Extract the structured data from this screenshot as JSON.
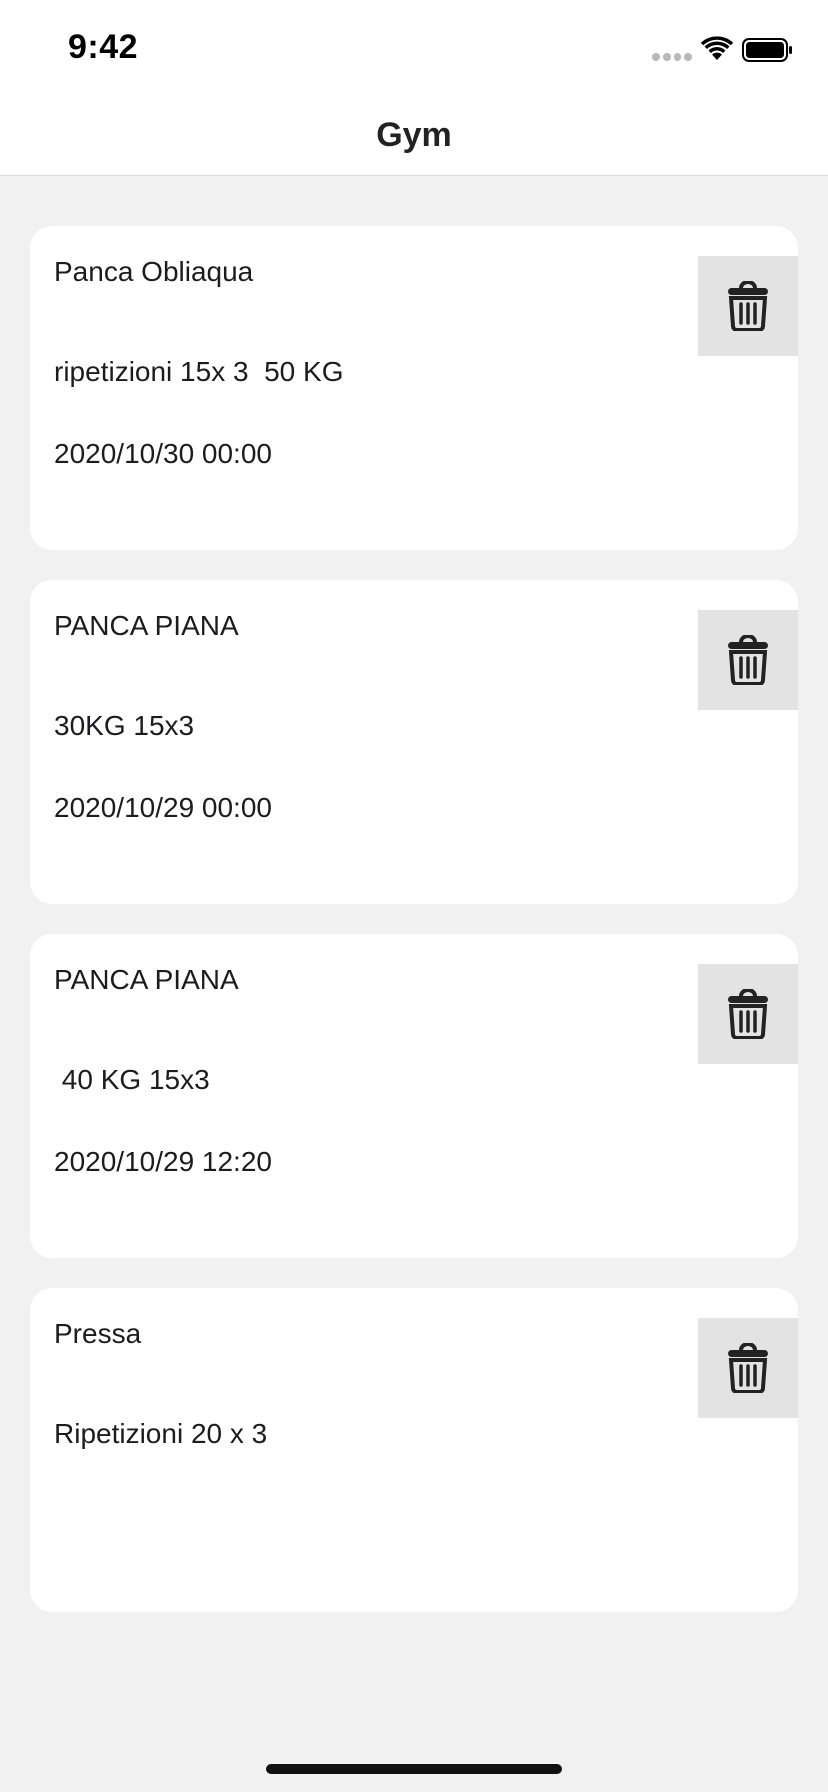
{
  "status_bar": {
    "time": "9:42",
    "icons": [
      "signal-icon",
      "wifi-icon",
      "battery-icon"
    ]
  },
  "nav": {
    "title": "Gym"
  },
  "workouts": [
    {
      "name": "Panca Obliaqua",
      "description": "ripetizioni 15x 3  50 KG",
      "date": "2020/10/30 00:00",
      "delete_icon": "trash-icon"
    },
    {
      "name": "PANCA PIANA",
      "description": "30KG 15x3",
      "date": "2020/10/29 00:00",
      "delete_icon": "trash-icon"
    },
    {
      "name": "PANCA PIANA",
      "description": " 40 KG 15x3",
      "date": "2020/10/29 12:20",
      "delete_icon": "trash-icon"
    },
    {
      "name": "Pressa",
      "description": "Ripetizioni 20 x 3",
      "date": "",
      "delete_icon": "trash-icon"
    }
  ],
  "colors": {
    "background": "#f1f1f1",
    "card": "#ffffff",
    "delete_button_bg": "#e3e3e3",
    "text": "#1c1c1e"
  }
}
